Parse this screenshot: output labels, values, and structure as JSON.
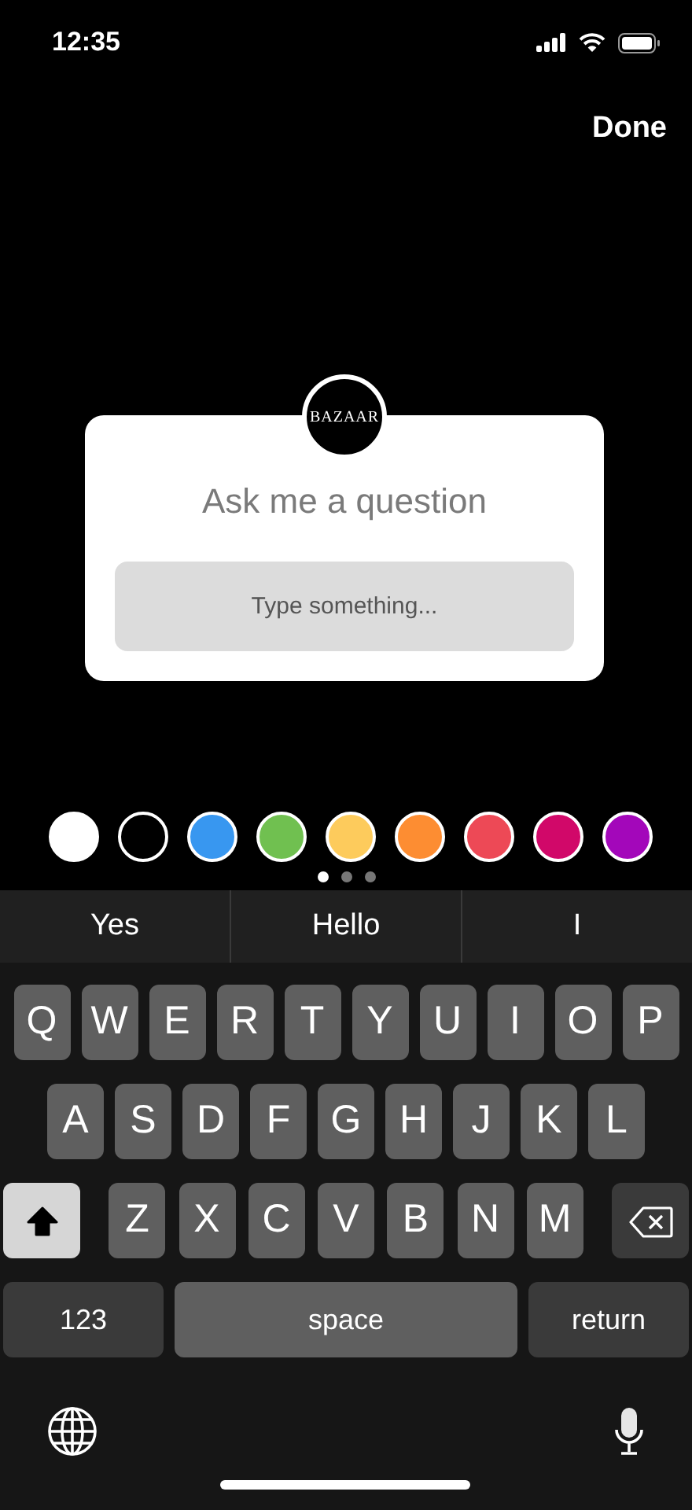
{
  "status_bar": {
    "time": "12:35"
  },
  "done_label": "Done",
  "question_card": {
    "avatar_text": "BAZAAR",
    "title": "Ask me a question",
    "placeholder": "Type something..."
  },
  "colors": [
    {
      "color": "#ffffff"
    },
    {
      "color": "#000000"
    },
    {
      "color": "#3897f0"
    },
    {
      "color": "#70c050"
    },
    {
      "color": "#fdcb5c"
    },
    {
      "color": "#fd8d32"
    },
    {
      "color": "#ed4956"
    },
    {
      "color": "#d10869"
    },
    {
      "color": "#a307ba"
    }
  ],
  "pages": [
    {
      "selected": true
    },
    {
      "selected": false
    },
    {
      "selected": false
    }
  ],
  "suggestions": [
    "Yes",
    "Hello",
    "I"
  ],
  "keyboard": {
    "top_row": [
      {
        "kind": "letter",
        "label": "Q"
      },
      {
        "kind": "letter",
        "label": "W"
      },
      {
        "kind": "letter",
        "label": "E"
      },
      {
        "kind": "letter",
        "label": "R"
      },
      {
        "kind": "letter",
        "label": "T"
      },
      {
        "kind": "letter",
        "label": "Y"
      },
      {
        "kind": "letter",
        "label": "U"
      },
      {
        "kind": "letter",
        "label": "I"
      },
      {
        "kind": "letter",
        "label": "O"
      },
      {
        "kind": "letter",
        "label": "P"
      }
    ],
    "middle_row": [
      {
        "kind": "letter",
        "label": "A"
      },
      {
        "kind": "letter",
        "label": "S"
      },
      {
        "kind": "letter",
        "label": "D"
      },
      {
        "kind": "letter",
        "label": "F"
      },
      {
        "kind": "letter",
        "label": "G"
      },
      {
        "kind": "letter",
        "label": "H"
      },
      {
        "kind": "letter",
        "label": "J"
      },
      {
        "kind": "letter",
        "label": "K"
      },
      {
        "kind": "letter",
        "label": "L"
      }
    ],
    "lower_row": [
      {
        "kind": "shift",
        "on": true
      },
      {
        "kind": "letter",
        "label": "Z"
      },
      {
        "kind": "letter",
        "label": "X"
      },
      {
        "kind": "letter",
        "label": "C"
      },
      {
        "kind": "letter",
        "label": "V"
      },
      {
        "kind": "letter",
        "label": "B"
      },
      {
        "kind": "letter",
        "label": "N"
      },
      {
        "kind": "letter",
        "label": "M"
      },
      {
        "kind": "delete"
      }
    ],
    "bottom_row": [
      {
        "kind": "numbers",
        "label": "123"
      },
      {
        "kind": "space",
        "label": "space"
      },
      {
        "kind": "return",
        "label": "return"
      }
    ]
  }
}
